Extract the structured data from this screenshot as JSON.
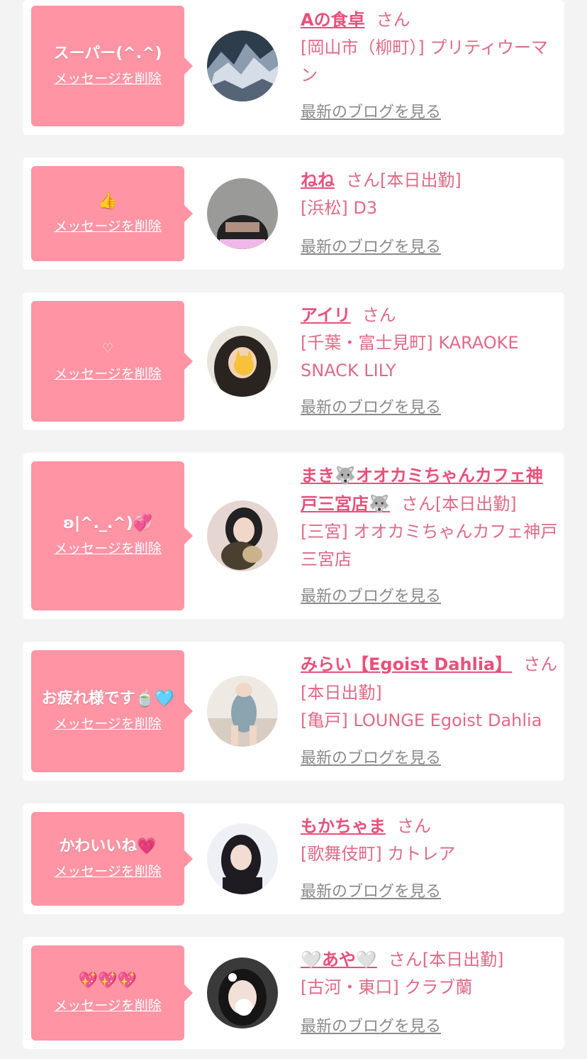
{
  "delete_label": "メッセージを削除",
  "blog_label": "最新のブログを見る",
  "colors": {
    "bubble": "#ff94a4",
    "name": "#e8507a",
    "text": "#e06a86",
    "link_gray": "#8a8a8a"
  },
  "cards": [
    {
      "message": "スーパー(^.^)",
      "name": "Aの食卓",
      "suffix": "さん",
      "shop": "[岡山市（柳町）] プリティウーマン"
    },
    {
      "message": "👍",
      "name": "ねね",
      "suffix": "さん[本日出勤]",
      "shop": "[浜松] D3"
    },
    {
      "message": "♡",
      "name": "アイリ",
      "suffix": "さん",
      "shop": "[千葉・富士見町] KARAOKE SNACK LILY"
    },
    {
      "message": "ʚ|^._.^)💞",
      "name": "まき🐺オオカミちゃんカフェ神戸三宮店🐺",
      "suffix": "さん[本日出勤]",
      "shop": "[三宮] オオカミちゃんカフェ神戸三宮店"
    },
    {
      "message": "お疲れ様です🍵🩵",
      "name": "みらい【Egoist Dahlia】",
      "suffix": "さん[本日出勤]",
      "shop": "[亀戸] LOUNGE Egoist Dahlia"
    },
    {
      "message": "かわいいね💗",
      "name": "もかちゃま",
      "suffix": "さん",
      "shop": "[歌舞伎町] カトレア"
    },
    {
      "message": "💖💖💖",
      "name": "🤍あや🤍",
      "suffix": "さん[本日出勤]",
      "shop": "[古河・東口] クラブ蘭"
    }
  ]
}
